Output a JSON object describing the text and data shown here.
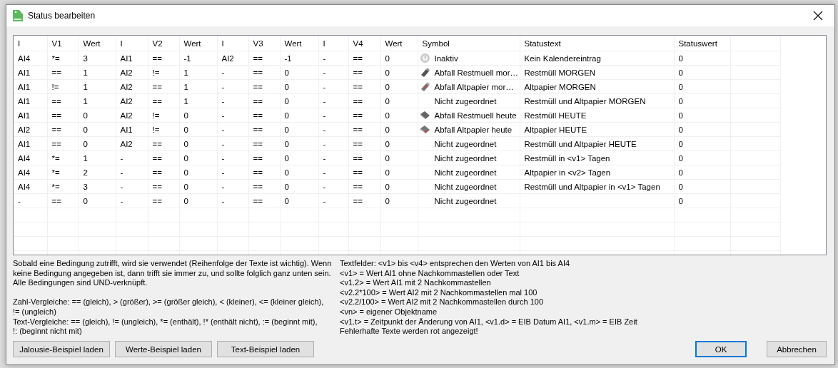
{
  "window": {
    "title": "Status bearbeiten"
  },
  "table": {
    "columns": [
      "I",
      "V1",
      "Wert",
      "I",
      "V2",
      "Wert",
      "I",
      "V3",
      "Wert",
      "I",
      "V4",
      "Wert",
      "Symbol",
      "Statustext",
      "Statuswert"
    ],
    "rows": [
      {
        "conditions": [
          "AI4",
          "*=",
          "3",
          "AI1",
          "==",
          "-1",
          "AI2",
          "==",
          "-1",
          "-",
          "==",
          "0"
        ],
        "symbol": {
          "kind": "dial",
          "label": "Inaktiv"
        },
        "status_text": "Kein Kalendereintrag",
        "status_value": "0"
      },
      {
        "conditions": [
          "AI1",
          "==",
          "1",
          "AI2",
          "!=",
          "1",
          "-",
          "==",
          "0",
          "-",
          "==",
          "0"
        ],
        "symbol": {
          "kind": "bin",
          "label": "Abfall Restmuell mor…"
        },
        "status_text": "Restmüll MORGEN",
        "status_value": "0"
      },
      {
        "conditions": [
          "AI1",
          "!=",
          "1",
          "AI2",
          "==",
          "1",
          "-",
          "==",
          "0",
          "-",
          "==",
          "0"
        ],
        "symbol": {
          "kind": "bin_red",
          "label": "Abfall Altpapier mor…"
        },
        "status_text": "Altpapier MORGEN",
        "status_value": "0"
      },
      {
        "conditions": [
          "AI1",
          "==",
          "1",
          "AI2",
          "==",
          "1",
          "-",
          "==",
          "0",
          "-",
          "==",
          "0"
        ],
        "symbol": {
          "label": "Nicht zugeordnet"
        },
        "status_text": "Restmüll und Altpapier MORGEN",
        "status_value": "0"
      },
      {
        "conditions": [
          "AI1",
          "==",
          "0",
          "AI2",
          "!=",
          "0",
          "-",
          "==",
          "0",
          "-",
          "==",
          "0"
        ],
        "symbol": {
          "kind": "box",
          "label": "Abfall Restmuell heute"
        },
        "status_text": "Restmüll HEUTE",
        "status_value": "0"
      },
      {
        "conditions": [
          "AI2",
          "==",
          "0",
          "AI1",
          "!=",
          "0",
          "-",
          "==",
          "0",
          "-",
          "==",
          "0"
        ],
        "symbol": {
          "kind": "box_red",
          "label": "Abfall Altpapier heute"
        },
        "status_text": "Altpapier HEUTE",
        "status_value": "0"
      },
      {
        "conditions": [
          "AI1",
          "==",
          "0",
          "AI2",
          "==",
          "0",
          "-",
          "==",
          "0",
          "-",
          "==",
          "0"
        ],
        "symbol": {
          "label": "Nicht zugeordnet"
        },
        "status_text": "Restmüll und Altpapier HEUTE",
        "status_value": "0"
      },
      {
        "conditions": [
          "AI4",
          "*=",
          "1",
          "-",
          "==",
          "0",
          "-",
          "==",
          "0",
          "-",
          "==",
          "0"
        ],
        "symbol": {
          "label": "Nicht zugeordnet"
        },
        "status_text": "Restmüll in <v1> Tagen",
        "status_value": "0"
      },
      {
        "conditions": [
          "AI4",
          "*=",
          "2",
          "-",
          "==",
          "0",
          "-",
          "==",
          "0",
          "-",
          "==",
          "0"
        ],
        "symbol": {
          "label": "Nicht zugeordnet"
        },
        "status_text": "Altpapier in <v2> Tagen",
        "status_value": "0"
      },
      {
        "conditions": [
          "AI4",
          "*=",
          "3",
          "-",
          "==",
          "0",
          "-",
          "==",
          "0",
          "-",
          "==",
          "0"
        ],
        "symbol": {
          "label": "Nicht zugeordnet"
        },
        "status_text": "Restmüll und Altpapier in <v1> Tagen",
        "status_value": "0"
      },
      {
        "conditions": [
          "-",
          "==",
          "0",
          "-",
          "==",
          "0",
          "-",
          "==",
          "0",
          "-",
          "==",
          "0"
        ],
        "symbol": {
          "label": "Nicht zugeordnet"
        },
        "status_value": "0"
      }
    ]
  },
  "help_left": [
    {
      "lines": [
        "Sobald eine Bedingung zutrifft, wird sie verwendet (Reihenfolge der Texte ist wichtig). Wenn",
        "keine Bedingung angegeben ist, dann trifft sie immer zu, und sollte folglich ganz unten sein.",
        "Alle Bedingungen sind UND-verknüpft."
      ]
    },
    {
      "lines": [
        "Zahl-Vergleiche: == (gleich), > (größer), >= (größer gleich), < (kleiner), <= (kleiner gleich),",
        "!= (ungleich)",
        "Text-Vergleiche: == (gleich), != (ungleich), *= (enthält), !* (enthält nicht), := (beginnt mit),",
        "!: (beginnt nicht mit)"
      ]
    }
  ],
  "help_right": [
    "Textfelder: <v1> bis <v4> entsprechen den Werten von AI1 bis AI4",
    "<v1> = Wert AI1 ohne Nachkommastellen oder Text",
    "<v1.2> = Wert AI1 mit 2 Nachkommastellen",
    "<v2.2*100> = Wert AI2 mit 2 Nachkommastellen mal 100",
    "<v2.2/100> = Wert AI2 mit 2 Nachkommastellen durch 100",
    "<vn> = eigener Objektname",
    "<v1.t> = Zeitpunkt der Änderung von AI1, <v1.d> = EIB Datum AI1, <v1.m> = EIB Zeit",
    "Fehlerhafte Texte werden rot angezeigt!"
  ],
  "example_buttons": [
    "Jalousie-Beispiel laden",
    "Werte-Beispiel laden",
    "Text-Beispiel laden"
  ],
  "dialog_buttons": [
    {
      "label": "OK",
      "default": true
    },
    {
      "label": "Abbrechen",
      "default": false
    }
  ]
}
